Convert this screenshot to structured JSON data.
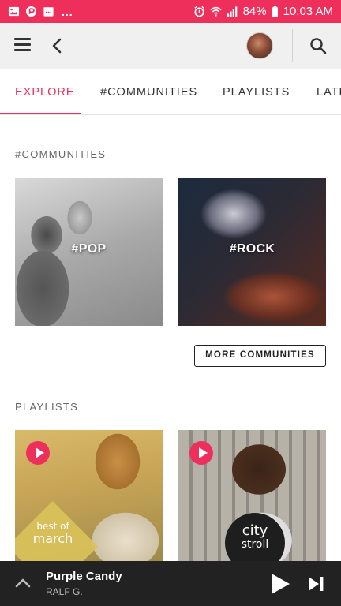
{
  "status_bar": {
    "battery": "84%",
    "time": "10:03 AM",
    "more": "...",
    "color": "#ef2f5b"
  },
  "app_bar": {
    "menu_icon": "hamburger-icon",
    "back_icon": "back-arrow-icon",
    "search_icon": "search-icon"
  },
  "tabs": [
    {
      "label": "EXPLORE",
      "active": true
    },
    {
      "label": "#COMMUNITIES",
      "active": false
    },
    {
      "label": "PLAYLISTS",
      "active": false
    },
    {
      "label": "LATE",
      "active": false
    }
  ],
  "communities": {
    "heading": "#COMMUNITIES",
    "items": [
      {
        "label": "#POP"
      },
      {
        "label": "#ROCK"
      }
    ],
    "more_label": "MORE COMMUNITIES"
  },
  "playlists": {
    "heading": "PLAYLISTS",
    "items": [
      {
        "badge_line1": "best of",
        "badge_line2": "march"
      },
      {
        "badge_line1": "city",
        "badge_line2": "stroll"
      }
    ]
  },
  "player": {
    "title": "Purple Candy",
    "artist": "RALF G."
  },
  "colors": {
    "accent": "#ef2f5b",
    "player_bg": "#222222"
  }
}
